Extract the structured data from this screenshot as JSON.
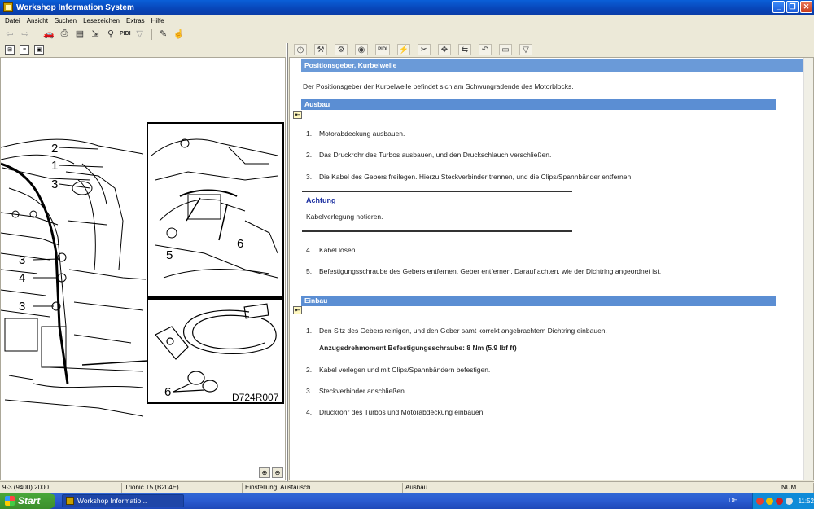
{
  "window": {
    "title": "Workshop Information System"
  },
  "menu": [
    "Datei",
    "Ansicht",
    "Suchen",
    "Lesezeichen",
    "Extras",
    "Hilfe"
  ],
  "toolbar": {
    "pidi_label": "PIDI"
  },
  "right_toolbar": {
    "pidi_label": "PIDI"
  },
  "figure": {
    "callouts": [
      "2",
      "1",
      "3",
      "3",
      "4",
      "3",
      "5",
      "6",
      "6"
    ],
    "figure_code": "D724R007"
  },
  "document": {
    "title": "Positionsgeber, Kurbelwelle",
    "intro": "Der Positionsgeber der Kurbelwelle befindet sich am Schwungradende des Motorblocks.",
    "ausbau": {
      "heading": "Ausbau",
      "steps_before_note": [
        {
          "num": "1.",
          "text": "Motorabdeckung ausbauen."
        },
        {
          "num": "2.",
          "text": "Das Druckrohr des Turbos ausbauen, und den Druckschlauch verschließen."
        },
        {
          "num": "3.",
          "text": "Die Kabel des Gebers freilegen. Hierzu Steckverbinder trennen, und die Clips/Spannbänder entfernen."
        }
      ],
      "note": {
        "title": "Achtung",
        "text": "Kabelverlegung notieren."
      },
      "steps_after_note": [
        {
          "num": "4.",
          "text": "Kabel lösen."
        },
        {
          "num": "5.",
          "text": "Befestigungsschraube des Gebers entfernen. Geber entfernen. Darauf achten, wie der Dichtring angeordnet ist."
        }
      ]
    },
    "einbau": {
      "heading": "Einbau",
      "step1": {
        "num": "1.",
        "text": "Den Sitz des Gebers reinigen, und den Geber samt korrekt angebrachtem Dichtring einbauen."
      },
      "torque": "Anzugsdrehmoment Befestigungsschraube: 8 Nm (5.9 lbf ft)",
      "steps": [
        {
          "num": "2.",
          "text": "Kabel verlegen und mit Clips/Spannbändern befestigen."
        },
        {
          "num": "3.",
          "text": "Steckverbinder anschließen."
        },
        {
          "num": "4.",
          "text": "Druckrohr des Turbos und Motorabdeckung einbauen."
        }
      ]
    }
  },
  "status": {
    "vehicle": "9-3 (9400) 2000",
    "engine": "Trionic T5 (B204E)",
    "category": "Einstellung, Austausch",
    "section": "Ausbau",
    "numlock": "NUM"
  },
  "taskbar": {
    "start_label": "Start",
    "task_label": "Workshop Informatio...",
    "language": "DE",
    "clock": "11:52"
  }
}
